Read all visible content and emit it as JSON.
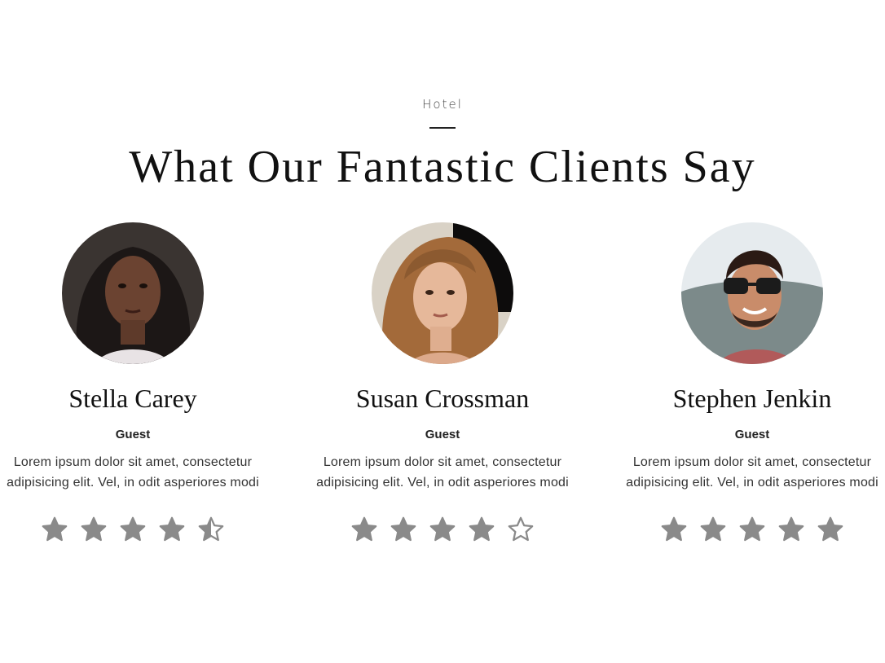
{
  "section": {
    "eyebrow": "Hotel",
    "title": "What Our Fantastic Clients Say"
  },
  "testimonials": [
    {
      "name": "Stella Carey",
      "role": "Guest",
      "quote": "Lorem ipsum dolor sit amet, consectetur adipisicing elit. Vel, in odit asperiores modi",
      "rating": 4.5,
      "rating_max": 5
    },
    {
      "name": "Susan Crossman",
      "role": "Guest",
      "quote": "Lorem ipsum dolor sit amet, consectetur adipisicing elit. Vel, in odit asperiores modi",
      "rating": 4,
      "rating_max": 5
    },
    {
      "name": "Stephen Jenkin",
      "role": "Guest",
      "quote": "Lorem ipsum dolor sit amet, consectetur adipisicing elit. Vel, in odit asperiores modi",
      "rating": 5,
      "rating_max": 5
    }
  ],
  "colors": {
    "star": "#8a8a8a",
    "text": "#111111"
  }
}
